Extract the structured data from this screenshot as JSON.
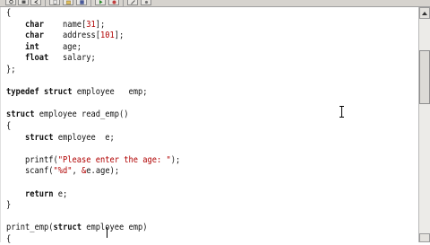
{
  "toolbar": {
    "buttons": [
      "refresh-icon",
      "stop-icon",
      "back-icon",
      "new-icon",
      "open-icon",
      "save-icon",
      "run-icon",
      "debug-icon",
      "build-icon",
      "options-icon"
    ]
  },
  "code": {
    "lines": [
      "{",
      "    char    name[31];",
      "    char    address[101];",
      "    int     age;",
      "    float   salary;",
      "};",
      "",
      "typedef struct employee   emp;",
      "",
      "struct employee read_emp()",
      "{",
      "    struct employee  e;",
      "",
      "    printf(\"Please enter the age: \");",
      "    scanf(\"%d\", &e.age);",
      "",
      "    return e;",
      "}",
      "",
      "print_emp(struct employee emp)",
      "{"
    ]
  },
  "colors": {
    "keyword": "#111111",
    "literal": "#b00000",
    "toolbar": "#d6d3ce",
    "scrollbar": "#ecebe8"
  }
}
